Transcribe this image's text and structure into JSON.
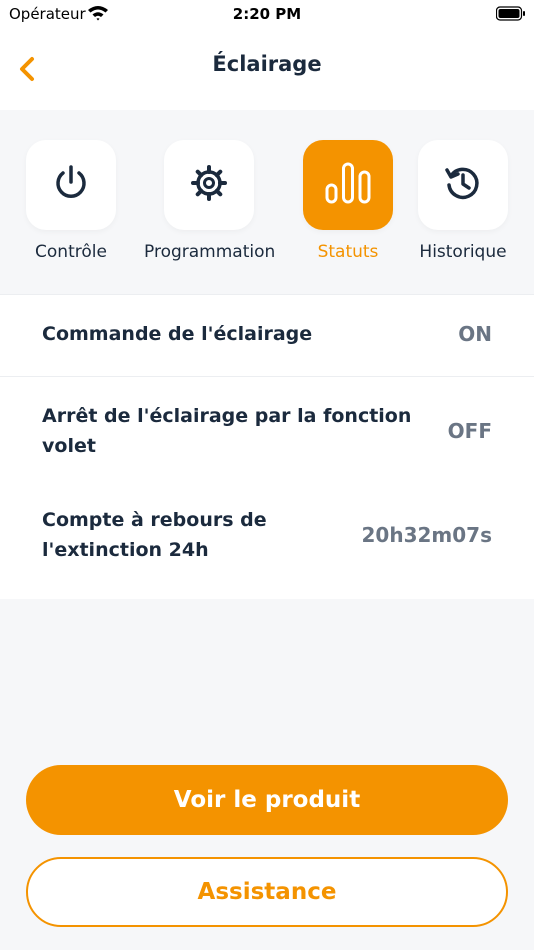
{
  "status_bar": {
    "carrier": "Opérateur",
    "time": "2:20 PM",
    "wifi_icon": "wifi-icon",
    "battery_icon": "battery-icon"
  },
  "nav": {
    "title": "Éclairage",
    "back_icon": "chevron-left-icon"
  },
  "tabs": [
    {
      "label": "Contrôle",
      "icon": "power-icon",
      "active": false
    },
    {
      "label": "Programmation",
      "icon": "gear-icon",
      "active": false
    },
    {
      "label": "Statuts",
      "icon": "bar-chart-icon",
      "active": true
    },
    {
      "label": "Historique",
      "icon": "history-icon",
      "active": false
    }
  ],
  "statuses": [
    {
      "label": "Commande de l'éclairage",
      "value": "ON"
    },
    {
      "label": "Arrêt de l'éclairage par la fonction volet",
      "value": "OFF"
    },
    {
      "label": "Compte à rebours de l'extinction 24h",
      "value": "20h32m07s"
    }
  ],
  "buttons": {
    "primary": "Voir le produit",
    "secondary": "Assistance"
  },
  "colors": {
    "accent": "#f49300",
    "text_dark": "#1b2a3d",
    "value_gray": "#6a7584",
    "background": "#f6f7f9"
  }
}
